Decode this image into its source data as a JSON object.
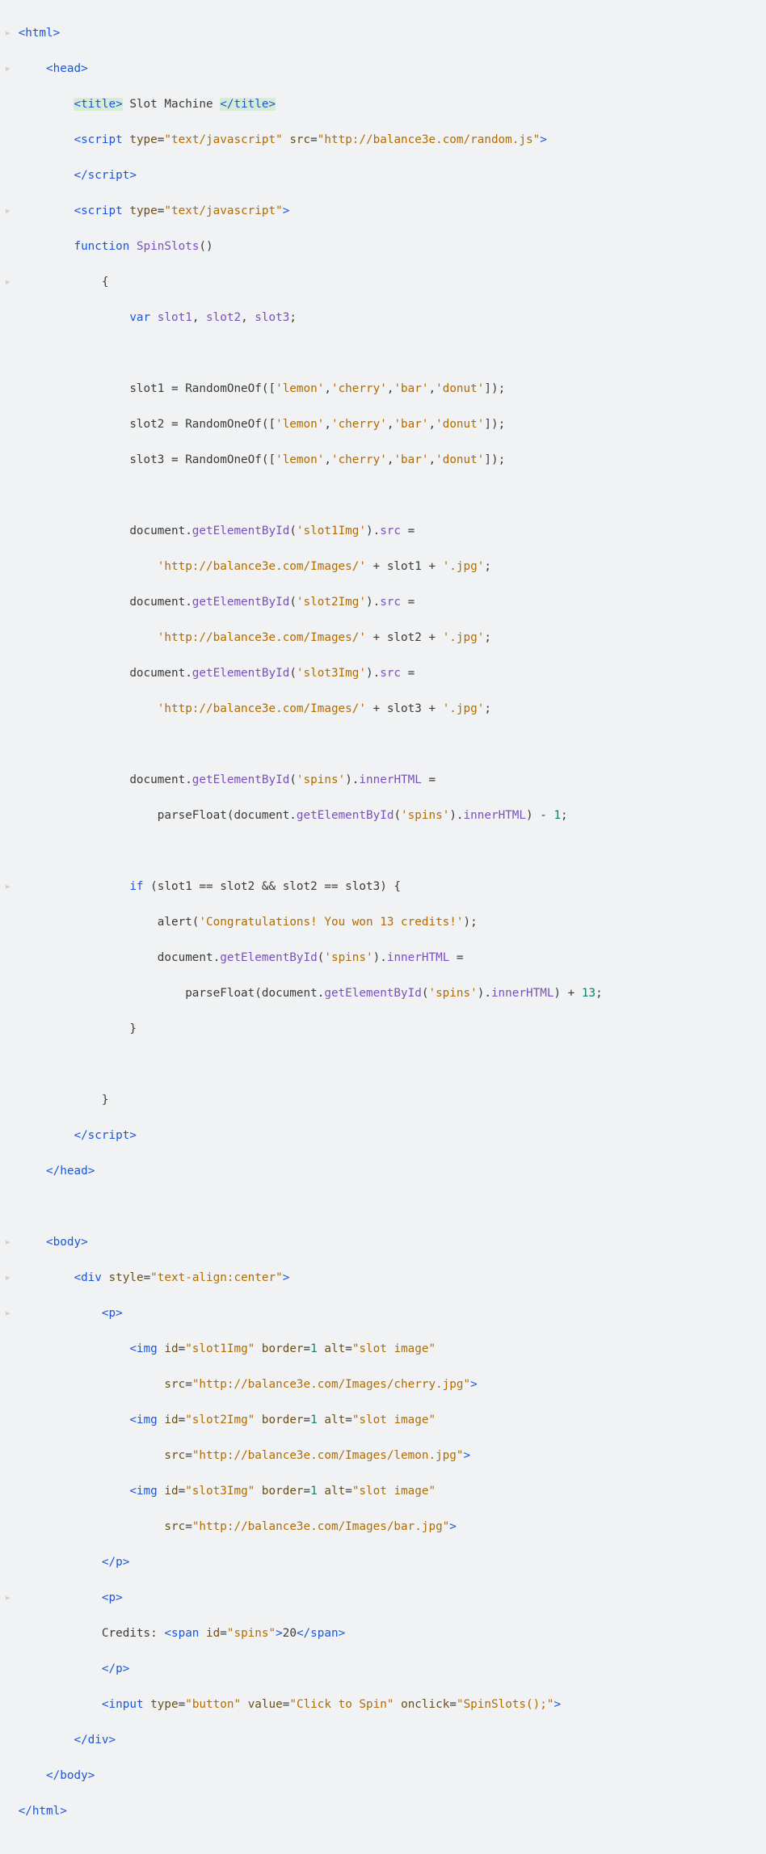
{
  "code": {
    "l01_a": "<html>",
    "l02_a": "<head>",
    "l03_a": "<title>",
    "l03_b": " Slot Machine ",
    "l03_c": "</title>",
    "l04_a": "<script",
    "l04_b": " type",
    "l04_c": "=",
    "l04_d": "\"text/javascript\"",
    "l04_e": " src",
    "l04_f": "=",
    "l04_g": "\"http://balance3e.com/random.js\"",
    "l04_h": ">",
    "l05_a": "</script>",
    "l06_a": "<script",
    "l06_b": " type",
    "l06_c": "=",
    "l06_d": "\"text/javascript\"",
    "l06_e": ">",
    "l07_a": "function",
    "l07_b": " ",
    "l07_c": "SpinSlots",
    "l07_d": "()",
    "l08_a": "{",
    "l09_a": "var",
    "l09_b": " ",
    "l09_c": "slot1",
    "l09_d": ", ",
    "l09_e": "slot2",
    "l09_f": ", ",
    "l09_g": "slot3",
    "l09_h": ";",
    "l11_a": "slot1 = RandomOneOf([",
    "l11_b": "'lemon'",
    "l11_c": ",",
    "l11_d": "'cherry'",
    "l11_e": ",",
    "l11_f": "'bar'",
    "l11_g": ",",
    "l11_h": "'donut'",
    "l11_i": "]);",
    "l12_a": "slot2 = RandomOneOf([",
    "l12_b": "'lemon'",
    "l12_c": ",",
    "l12_d": "'cherry'",
    "l12_e": ",",
    "l12_f": "'bar'",
    "l12_g": ",",
    "l12_h": "'donut'",
    "l12_i": "]);",
    "l13_a": "slot3 = RandomOneOf([",
    "l13_b": "'lemon'",
    "l13_c": ",",
    "l13_d": "'cherry'",
    "l13_e": ",",
    "l13_f": "'bar'",
    "l13_g": ",",
    "l13_h": "'donut'",
    "l13_i": "]);",
    "l15_a": "document.",
    "l15_b": "getElementById",
    "l15_c": "(",
    "l15_d": "'slot1Img'",
    "l15_e": ").",
    "l15_f": "src",
    "l15_g": " = ",
    "l16_a": "'http://balance3e.com/Images/'",
    "l16_b": " + slot1 + ",
    "l16_c": "'.jpg'",
    "l16_d": ";",
    "l17_a": "document.",
    "l17_b": "getElementById",
    "l17_c": "(",
    "l17_d": "'slot2Img'",
    "l17_e": ").",
    "l17_f": "src",
    "l17_g": " = ",
    "l18_a": "'http://balance3e.com/Images/'",
    "l18_b": " + slot2 + ",
    "l18_c": "'.jpg'",
    "l18_d": ";",
    "l19_a": "document.",
    "l19_b": "getElementById",
    "l19_c": "(",
    "l19_d": "'slot3Img'",
    "l19_e": ").",
    "l19_f": "src",
    "l19_g": " = ",
    "l20_a": "'http://balance3e.com/Images/'",
    "l20_b": " + slot3 + ",
    "l20_c": "'.jpg'",
    "l20_d": ";",
    "l22_a": "document.",
    "l22_b": "getElementById",
    "l22_c": "(",
    "l22_d": "'spins'",
    "l22_e": ").",
    "l22_f": "innerHTML",
    "l22_g": " = ",
    "l23_a": "parseFloat(document.",
    "l23_b": "getElementById",
    "l23_c": "(",
    "l23_d": "'spins'",
    "l23_e": ").",
    "l23_f": "innerHTML",
    "l23_g": ") - ",
    "l23_h": "1",
    "l23_i": ";",
    "l25_a": "if",
    "l25_b": " (slot1 == slot2 && slot2 == slot3) {",
    "l26_a": "alert(",
    "l26_b": "'Congratulations! You won 13 credits!'",
    "l26_c": ");",
    "l27_a": "document.",
    "l27_b": "getElementById",
    "l27_c": "(",
    "l27_d": "'spins'",
    "l27_e": ").",
    "l27_f": "innerHTML",
    "l27_g": " = ",
    "l28_a": "parseFloat(document.",
    "l28_b": "getElementById",
    "l28_c": "(",
    "l28_d": "'spins'",
    "l28_e": ").",
    "l28_f": "innerHTML",
    "l28_g": ") + ",
    "l28_h": "13",
    "l28_i": ";",
    "l29_a": "}",
    "l31_a": "}",
    "l32_a": "</script>",
    "l33_a": "</head>",
    "l35_a": "<body>",
    "l36_a": "<div",
    "l36_b": " style",
    "l36_c": "=",
    "l36_d": "\"text-align:center\"",
    "l36_e": ">",
    "l37_a": "<p>",
    "l38_a": "<img",
    "l38_b": " id",
    "l38_c": "=",
    "l38_d": "\"slot1Img\"",
    "l38_e": " border",
    "l38_f": "=",
    "l38_g": "1",
    "l38_h": " alt",
    "l38_i": "=",
    "l38_j": "\"slot image\"",
    "l39_a": " src",
    "l39_b": "=",
    "l39_c": "\"http://balance3e.com/Images/cherry.jpg\"",
    "l39_d": ">",
    "l40_a": "<img",
    "l40_b": " id",
    "l40_c": "=",
    "l40_d": "\"slot2Img\"",
    "l40_e": " border",
    "l40_f": "=",
    "l40_g": "1",
    "l40_h": " alt",
    "l40_i": "=",
    "l40_j": "\"slot image\"",
    "l41_a": " src",
    "l41_b": "=",
    "l41_c": "\"http://balance3e.com/Images/lemon.jpg\"",
    "l41_d": ">",
    "l42_a": "<img",
    "l42_b": " id",
    "l42_c": "=",
    "l42_d": "\"slot3Img\"",
    "l42_e": " border",
    "l42_f": "=",
    "l42_g": "1",
    "l42_h": " alt",
    "l42_i": "=",
    "l42_j": "\"slot image\"",
    "l43_a": " src",
    "l43_b": "=",
    "l43_c": "\"http://balance3e.com/Images/bar.jpg\"",
    "l43_d": ">",
    "l44_a": "</p>",
    "l45_a": "<p>",
    "l46_a": "Credits: ",
    "l46_b": "<span",
    "l46_c": " id",
    "l46_d": "=",
    "l46_e": "\"spins\"",
    "l46_f": ">",
    "l46_g": "20",
    "l46_h": "</span>",
    "l47_a": "</p>",
    "l48_a": "<input",
    "l48_b": " type",
    "l48_c": "=",
    "l48_d": "\"button\"",
    "l48_e": " value",
    "l48_f": "=",
    "l48_g": "\"Click to Spin\"",
    "l48_h": " onclick",
    "l48_i": "=",
    "l48_j": "\"SpinSlots();\"",
    "l48_k": ">",
    "l49_a": "</div>",
    "l50_a": "</body>",
    "l51_a": "</html>"
  },
  "marker": "▸"
}
